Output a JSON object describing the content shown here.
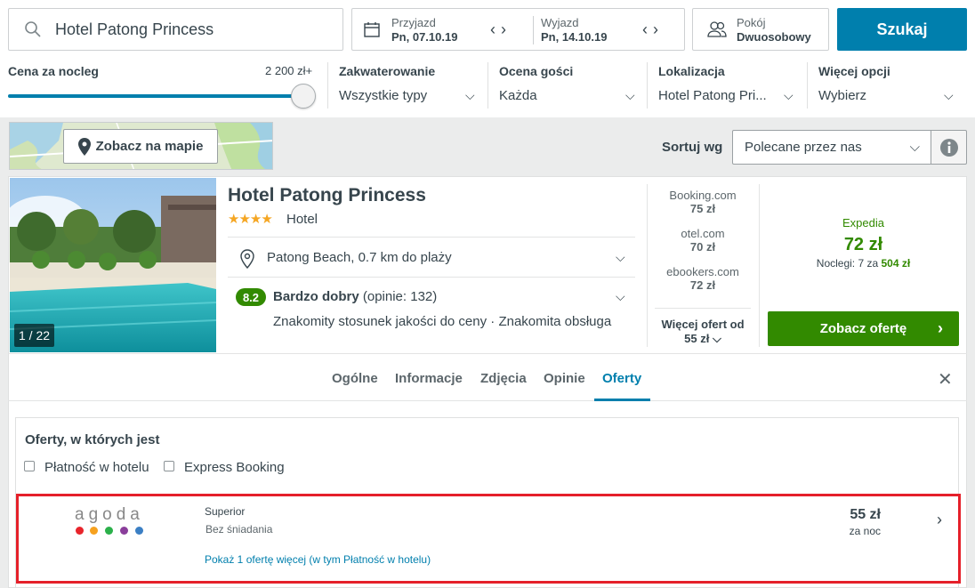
{
  "search": {
    "query": "Hotel Patong Princess",
    "button_label": "Szukaj"
  },
  "dates": {
    "checkin_label": "Przyjazd",
    "checkin_value": "Pn, 07.10.19",
    "checkout_label": "Wyjazd",
    "checkout_value": "Pn, 14.10.19"
  },
  "room": {
    "label": "Pokój",
    "value": "Dwuosobowy"
  },
  "filters": {
    "price_label": "Cena za nocleg",
    "price_max": "2 200 zł+",
    "price_fraction": 1.0,
    "accommodation_label": "Zakwaterowanie",
    "accommodation_value": "Wszystkie typy",
    "rating_label": "Ocena gości",
    "rating_value": "Każda",
    "location_label": "Lokalizacja",
    "location_value": "Hotel Patong Pri...",
    "more_label": "Więcej opcji",
    "more_value": "Wybierz"
  },
  "map_button": "Zobacz na mapie",
  "sort": {
    "label": "Sortuj wg",
    "value": "Polecane przez nas"
  },
  "hotel": {
    "name": "Hotel Patong Princess",
    "stars": "★★★★",
    "type": "Hotel",
    "photo_count": "1 / 22",
    "location": "Patong Beach, 0.7 km do plaży",
    "rating_score": "8.2",
    "rating_text": "Bardzo dobry",
    "rating_count": "(opinie: 132)",
    "rating_highlights": "Znakomity stosunek jakości do ceny · Znakomita obsługa",
    "alt_offers": [
      {
        "name": "Booking.com",
        "price": "75 zł"
      },
      {
        "name": "otel.com",
        "price": "70 zł"
      },
      {
        "name": "ebookers.com",
        "price": "72 zł"
      }
    ],
    "more_offers_line1": "Więcej ofert od",
    "more_offers_line2": "55 zł",
    "main_offer": {
      "provider": "Expedia",
      "price": "72 zł",
      "nights_prefix": "Noclegi: 7 za",
      "nights_total": "504 zł",
      "button": "Zobacz ofertę"
    }
  },
  "tabs": [
    "Ogólne",
    "Informacje",
    "Zdjęcia",
    "Opinie",
    "Oferty"
  ],
  "offers": {
    "title": "Oferty, w których jest",
    "checkbox_pay_at_hotel": "Płatność w hotelu",
    "checkbox_express": "Express Booking",
    "row": {
      "provider_logo_text": "agoda",
      "room_type": "Superior",
      "board": "Bez śniadania",
      "price": "55 zł",
      "per": "za noc",
      "more_link": "Pokaż 1 ofertę więcej (w tym Płatność w hotelu)"
    }
  },
  "colors": {
    "accent": "#007fad",
    "green": "#328a00",
    "highlight": "#e5202a"
  }
}
